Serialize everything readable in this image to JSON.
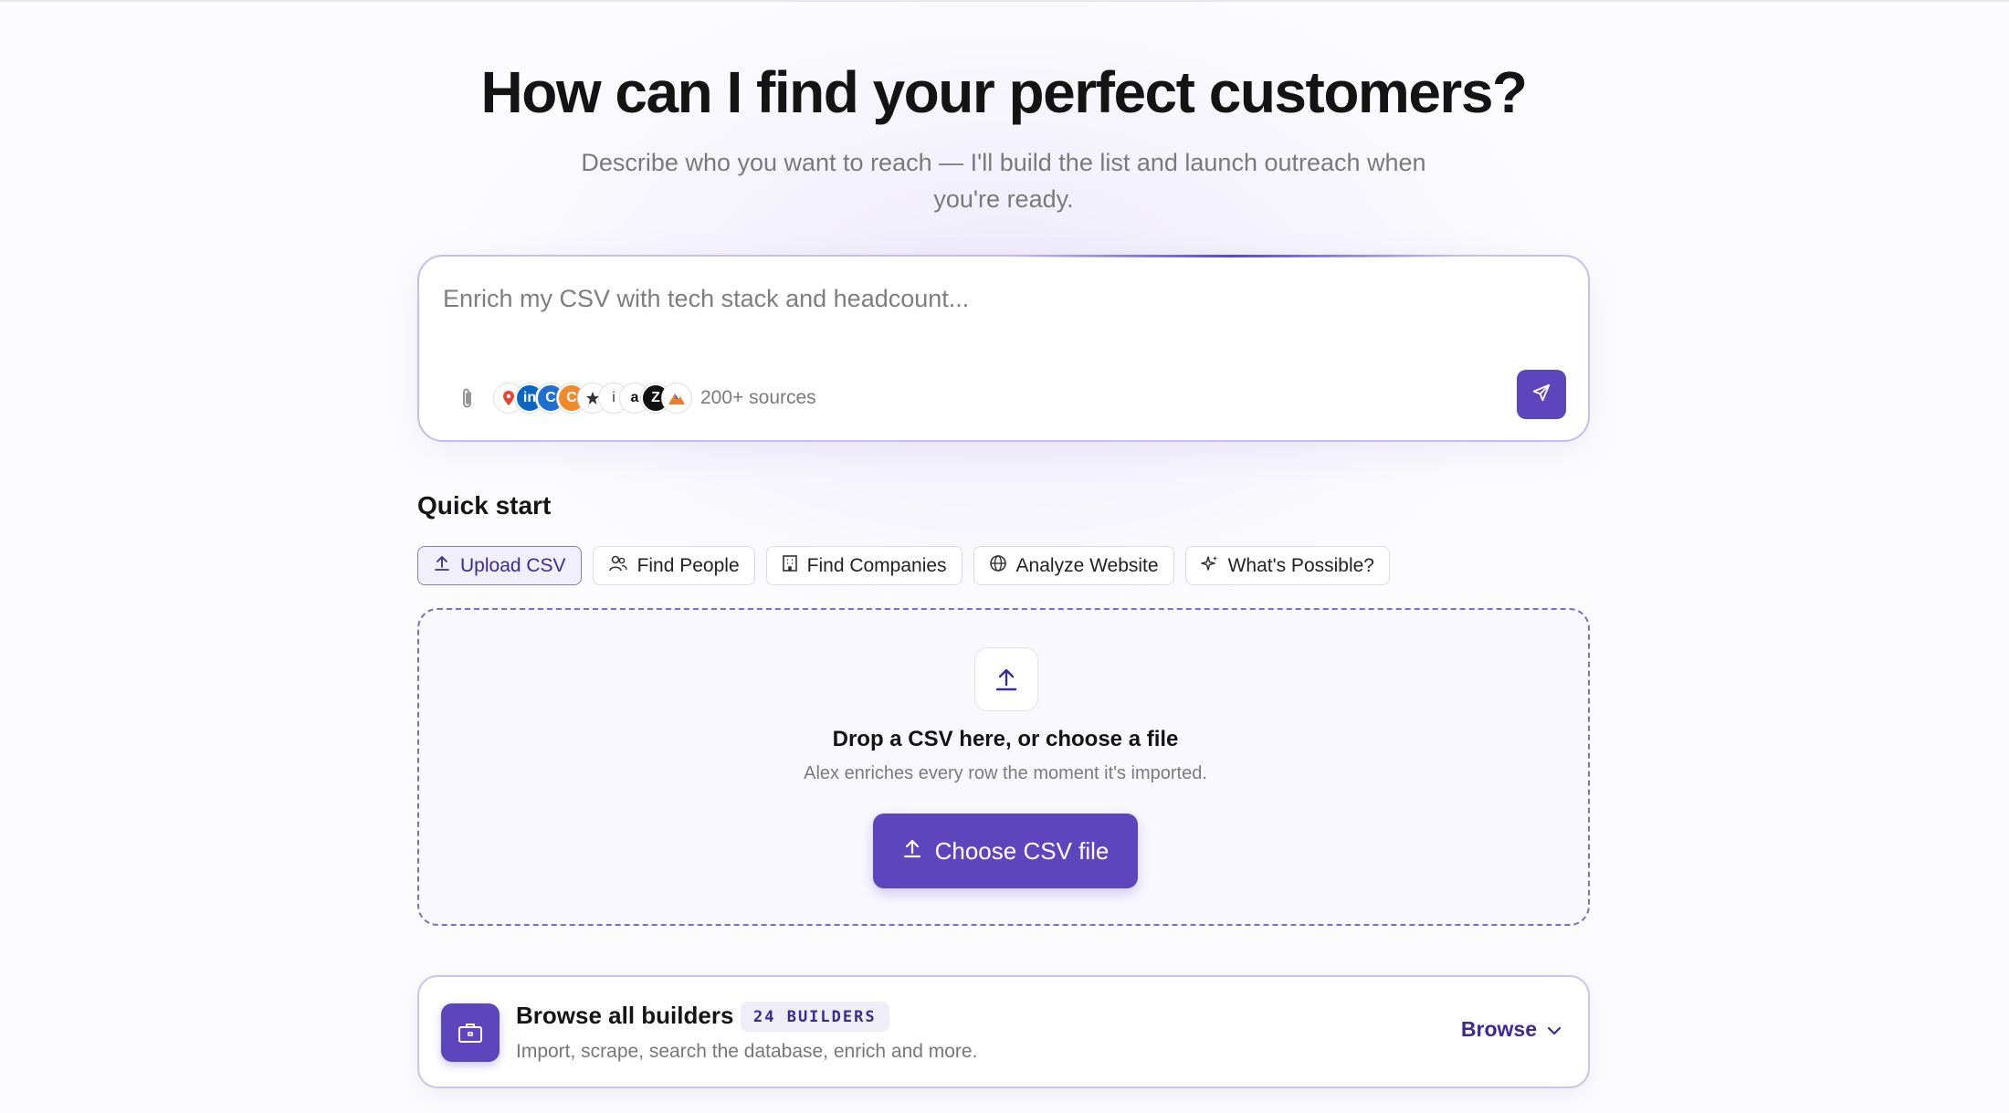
{
  "hero": {
    "title": "How can I find your perfect customers?",
    "subtitle": "Describe who you want to reach — I'll build the list and launch outreach when you're ready."
  },
  "prompt": {
    "placeholder": "Enrich my CSV with tech stack and headcount...",
    "sources_label": "200+ sources",
    "source_icons": [
      "maps-icon",
      "linkedin-icon",
      "crunchbase-icon",
      "company-icon",
      "apollo-icon",
      "info-icon",
      "amazon-icon",
      "zoominfo-icon",
      "alpine-icon"
    ],
    "attach_icon": "paperclip-icon",
    "send_icon": "send-icon"
  },
  "quick_start": {
    "title": "Quick start",
    "chips": [
      {
        "label": "Upload CSV",
        "icon": "upload-icon",
        "active": true
      },
      {
        "label": "Find People",
        "icon": "people-icon",
        "active": false
      },
      {
        "label": "Find Companies",
        "icon": "building-icon",
        "active": false
      },
      {
        "label": "Analyze Website",
        "icon": "globe-icon",
        "active": false
      },
      {
        "label": "What's Possible?",
        "icon": "sparkle-icon",
        "active": false
      }
    ]
  },
  "dropzone": {
    "title": "Drop a CSV here, or choose a file",
    "subtitle": "Alex enriches every row the moment it's imported.",
    "button_label": "Choose CSV file"
  },
  "builders": {
    "title": "Browse all builders",
    "badge": "24 BUILDERS",
    "subtitle": "Import, scrape, search the database, enrich and more.",
    "browse_label": "Browse"
  },
  "colors": {
    "accent": "#5d46bd",
    "accent_text": "#3b2a8f",
    "muted_text": "#7a7a7a"
  }
}
